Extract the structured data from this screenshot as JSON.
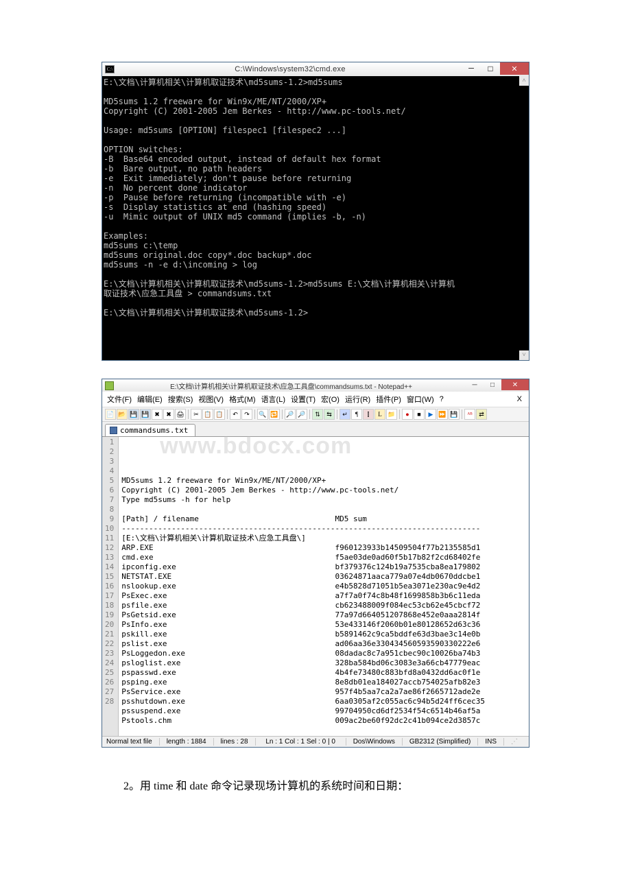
{
  "cmd": {
    "title": "C:\\Windows\\system32\\cmd.exe",
    "icon_text": "C:\\",
    "lines": [
      "E:\\文档\\计算机相关\\计算机取证技术\\md5sums-1.2>md5sums",
      "",
      "MD5sums 1.2 freeware for Win9x/ME/NT/2000/XP+",
      "Copyright (C) 2001-2005 Jem Berkes - http://www.pc-tools.net/",
      "",
      "Usage: md5sums [OPTION] filespec1 [filespec2 ...]",
      "",
      "OPTION switches:",
      "-B  Base64 encoded output, instead of default hex format",
      "-b  Bare output, no path headers",
      "-e  Exit immediately; don't pause before returning",
      "-n  No percent done indicator",
      "-p  Pause before returning (incompatible with -e)",
      "-s  Display statistics at end (hashing speed)",
      "-u  Mimic output of UNIX md5 command (implies -b, -n)",
      "",
      "Examples:",
      "md5sums c:\\temp",
      "md5sums original.doc copy*.doc backup*.doc",
      "md5sums -n -e d:\\incoming > log",
      "",
      "E:\\文档\\计算机相关\\计算机取证技术\\md5sums-1.2>md5sums E:\\文档\\计算机相关\\计算机",
      "取证技术\\应急工具盘 > commandsums.txt",
      "",
      "E:\\文档\\计算机相关\\计算机取证技术\\md5sums-1.2>"
    ]
  },
  "npp": {
    "title": "E:\\文档\\计算机相关\\计算机取证技术\\应急工具盘\\commandsums.txt - Notepad++",
    "menu": [
      "文件(F)",
      "编辑(E)",
      "搜索(S)",
      "视图(V)",
      "格式(M)",
      "语言(L)",
      "设置(T)",
      "宏(O)",
      "运行(R)",
      "插件(P)",
      "窗口(W)",
      "?"
    ],
    "tab": "commandsums.txt",
    "lines": [
      "",
      "MD5sums 1.2 freeware for Win9x/ME/NT/2000/XP+",
      "Copyright (C) 2001-2005 Jem Berkes - http://www.pc-tools.net/",
      "Type md5sums -h for help",
      "",
      "[Path] / filename                              MD5 sum",
      "-------------------------------------------------------------------------------",
      "[E:\\文档\\计算机相关\\计算机取证技术\\应急工具盘\\]",
      "ARP.EXE                                        f960123933b14509504f77b2135585d1",
      "cmd.exe                                        f5ae03de0ad60f5b17b82f2cd68402fe",
      "ipconfig.exe                                   bf379376c124b19a7535cba8ea179802",
      "NETSTAT.EXE                                    03624871aaca779a07e4db0670ddcbe1",
      "nslookup.exe                                   e4b5828d71051b5ea3071e230ac9e4d2",
      "PsExec.exe                                     a7f7a0f74c8b48f1699858b3b6c11eda",
      "psfile.exe                                     cb623488009f084ec53cb62e45cbcf72",
      "PsGetsid.exe                                   77a97d664051207868e452e0aaa2814f",
      "PsInfo.exe                                     53e433146f2060b01e80128652d63c36",
      "pskill.exe                                     b5891462c9ca5bddfe63d3bae3c14e0b",
      "pslist.exe                                     ad06aa36e330434560593590330222e6",
      "PsLoggedon.exe                                 08dadac8c7a951cbec90c10026ba74b3",
      "psloglist.exe                                  328ba584bd06c3083e3a66cb47779eac",
      "pspasswd.exe                                   4b4fe73480c883bfd8a0432dd6ac0f1e",
      "psping.exe                                     8e8db01ea184027accb754025afb82e3",
      "PsService.exe                                  957f4b5aa7ca2a7ae86f2665712ade2e",
      "psshutdown.exe                                 6aa0305af2c055ac6c94b5d24ff6cec35",
      "pssuspend.exe                                  99704950cd6df2534f54c6514b46af5a",
      "Pstools.chm                                    009ac2be60f92dc2c41b094ce2d3857c",
      ""
    ],
    "status": {
      "filetype": "Normal text file",
      "length": "length : 1884",
      "lines": "lines : 28",
      "pos": "Ln : 1   Col : 1   Sel : 0 | 0",
      "eol": "Dos\\Windows",
      "enc": "GB2312 (Simplified)",
      "mode": "INS"
    },
    "watermark": "www.bdocx.com"
  },
  "body_text": "2。用 time 和 date 命令记录现场计算机的系统时间和日期："
}
